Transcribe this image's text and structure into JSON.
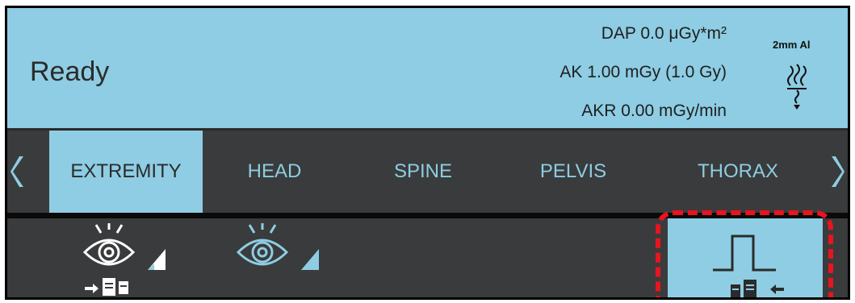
{
  "status": {
    "state": "Ready",
    "dap": "DAP 0.0 μGy*m²",
    "ak": "AK 1.00 mGy  (1.0 Gy)",
    "akr": "AKR 0.00 mGy/min",
    "filter": "2mm Al",
    "tube_icon": "x-ray-tube-icon"
  },
  "nav": {
    "tabs": [
      {
        "label": "EXTREMITY",
        "active": true
      },
      {
        "label": "HEAD",
        "active": false
      },
      {
        "label": "SPINE",
        "active": false
      },
      {
        "label": "PELVIS",
        "active": false
      },
      {
        "label": "THORAX",
        "active": false
      }
    ],
    "prev_icon": "chevron-left-icon",
    "next_icon": "chevron-right-icon"
  },
  "tools": {
    "items": [
      {
        "icon": "eye-image-to-display-icon",
        "active": false
      },
      {
        "icon": "eye-image-icon",
        "active": false
      },
      {
        "icon": "single-pulse-store-icon",
        "active": true,
        "highlighted": true
      }
    ]
  },
  "colors": {
    "accent": "#8ecde3",
    "panel": "#3a3b3c",
    "highlight": "#e8141e"
  }
}
